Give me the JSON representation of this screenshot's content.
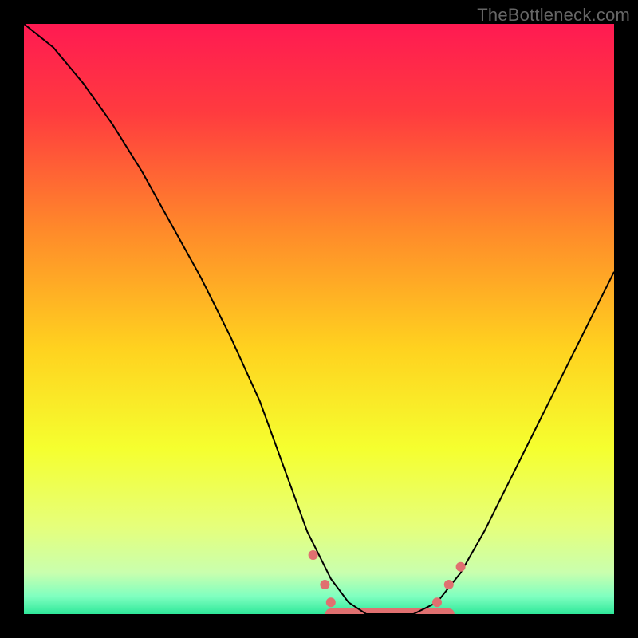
{
  "watermark": "TheBottleneck.com",
  "chart_data": {
    "type": "line",
    "title": "",
    "xlabel": "",
    "ylabel": "",
    "xlim": [
      0,
      100
    ],
    "ylim": [
      0,
      100
    ],
    "background": {
      "kind": "vertical-gradient",
      "stops": [
        {
          "pos": 0.0,
          "color": "#ff1a52"
        },
        {
          "pos": 0.15,
          "color": "#ff3b3f"
        },
        {
          "pos": 0.35,
          "color": "#ff8a2a"
        },
        {
          "pos": 0.55,
          "color": "#ffd21f"
        },
        {
          "pos": 0.72,
          "color": "#f5ff2f"
        },
        {
          "pos": 0.85,
          "color": "#e6ff7a"
        },
        {
          "pos": 0.93,
          "color": "#c9ffae"
        },
        {
          "pos": 0.97,
          "color": "#7fffc0"
        },
        {
          "pos": 1.0,
          "color": "#2fe89a"
        }
      ]
    },
    "series": [
      {
        "name": "bottleneck-curve",
        "color": "#000000",
        "stroke_width": 2,
        "x": [
          0,
          5,
          10,
          15,
          20,
          25,
          30,
          35,
          40,
          44,
          48,
          52,
          55,
          58,
          62,
          66,
          70,
          74,
          78,
          82,
          86,
          90,
          94,
          98,
          100
        ],
        "y": [
          100,
          96,
          90,
          83,
          75,
          66,
          57,
          47,
          36,
          25,
          14,
          6,
          2,
          0,
          0,
          0,
          2,
          7,
          14,
          22,
          30,
          38,
          46,
          54,
          58
        ]
      }
    ],
    "zero_band": {
      "x_start": 52,
      "x_end": 72,
      "color": "#e07070",
      "thickness": 14
    },
    "markers": [
      {
        "x": 49,
        "y": 10,
        "color": "#e07070",
        "r": 6
      },
      {
        "x": 51,
        "y": 5,
        "color": "#e07070",
        "r": 6
      },
      {
        "x": 52,
        "y": 2,
        "color": "#e07070",
        "r": 6
      },
      {
        "x": 70,
        "y": 2,
        "color": "#e07070",
        "r": 6
      },
      {
        "x": 72,
        "y": 5,
        "color": "#e07070",
        "r": 6
      },
      {
        "x": 74,
        "y": 8,
        "color": "#e07070",
        "r": 6
      }
    ]
  }
}
